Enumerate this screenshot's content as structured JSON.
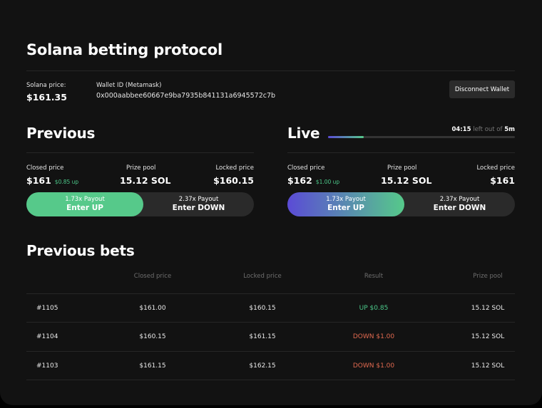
{
  "header": {
    "title": "Solana betting protocol"
  },
  "price_info": {
    "label": "Solana price:",
    "value": "$161.35"
  },
  "wallet": {
    "label": "Wallet ID (Metamask)",
    "id": "0x000aabbee60667e9ba7935b841131a6945572c7b"
  },
  "disconnect_label": "Disconnect Wallet",
  "previous": {
    "title": "Previous",
    "closed_label": "Closed price",
    "closed_value": "$161",
    "closed_delta": "$0.85 up",
    "pool_label": "Prize pool",
    "pool_value": "15.12 SOL",
    "locked_label": "Locked price",
    "locked_value": "$160.15",
    "up_payout": "1.73x Payout",
    "up_label": "Enter UP",
    "down_payout": "2.37x Payout",
    "down_label": "Enter DOWN"
  },
  "live": {
    "title": "Live",
    "timer_elapsed": "04:15",
    "timer_middle": "left out of",
    "timer_total": "5m",
    "progress": 0.19,
    "closed_label": "Closed price",
    "closed_value": "$162",
    "closed_delta": "$1.00 up",
    "pool_label": "Prize pool",
    "pool_value": "15.12 SOL",
    "locked_label": "Locked price",
    "locked_value": "$161",
    "up_payout": "1.73x Payout",
    "up_label": "Enter UP",
    "down_payout": "2.37x Payout",
    "down_label": "Enter DOWN"
  },
  "bets": {
    "title": "Previous bets",
    "headers": [
      "",
      "Closed price",
      "Locked price",
      "Result",
      "Prize pool"
    ],
    "rows": [
      {
        "id": "#1105",
        "closed": "$161.00",
        "locked": "$160.15",
        "result": "UP $0.85",
        "outcome": "win",
        "pool": "15.12 SOL"
      },
      {
        "id": "#1104",
        "closed": "$160.15",
        "locked": "$161.15",
        "result": "DOWN $1.00",
        "outcome": "lose",
        "pool": "15.12 SOL"
      },
      {
        "id": "#1103",
        "closed": "$161.15",
        "locked": "$162.15",
        "result": "DOWN $1.00",
        "outcome": "lose",
        "pool": "15.12 SOL"
      }
    ]
  },
  "colors": {
    "background": "#121212",
    "accent_green": "#56c98a",
    "accent_purple": "#5b4bd6",
    "loss_red": "#e0694f"
  }
}
